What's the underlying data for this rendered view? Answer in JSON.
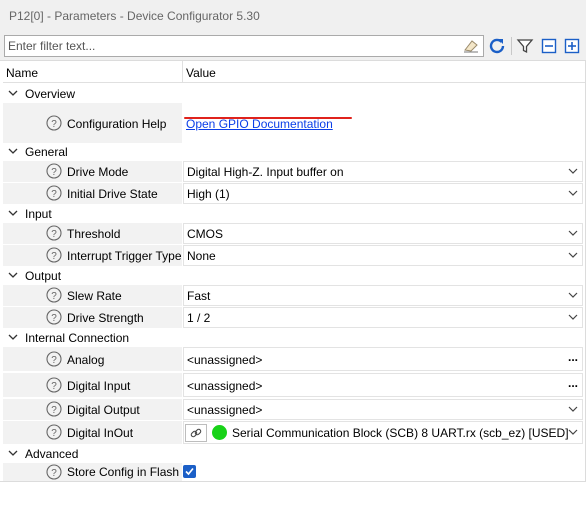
{
  "window": {
    "title": "P12[0] - Parameters - Device Configurator 5.30"
  },
  "filter": {
    "placeholder": "Enter filter text..."
  },
  "toolbar": {
    "icons": [
      "eraser-icon",
      "refresh-icon",
      "filter-icon",
      "collapse-icon",
      "expand-icon"
    ],
    "accent": "#1b5fc7"
  },
  "grid": {
    "headers": {
      "name": "Name",
      "value": "Value"
    },
    "overview": {
      "label": "Overview",
      "config_help": {
        "label": "Configuration Help",
        "value": "Open GPIO Documentation"
      }
    },
    "general": {
      "label": "General",
      "drive_mode": {
        "label": "Drive Mode",
        "value": "Digital High-Z. Input buffer on"
      },
      "initial_drive_state": {
        "label": "Initial Drive State",
        "value": "High (1)"
      }
    },
    "input": {
      "label": "Input",
      "threshold": {
        "label": "Threshold",
        "value": "CMOS"
      },
      "interrupt_trigger": {
        "label": "Interrupt Trigger Type",
        "value": "None"
      }
    },
    "output": {
      "label": "Output",
      "slew_rate": {
        "label": "Slew Rate",
        "value": "Fast"
      },
      "drive_strength": {
        "label": "Drive Strength",
        "value": "1 / 2"
      }
    },
    "internal_connection": {
      "label": "Internal Connection",
      "analog": {
        "label": "Analog",
        "value": "<unassigned>"
      },
      "digital_input": {
        "label": "Digital Input",
        "value": "<unassigned>"
      },
      "digital_output": {
        "label": "Digital Output",
        "value": "<unassigned>"
      },
      "digital_inout": {
        "label": "Digital InOut",
        "value": "Serial Communication Block (SCB) 8 UART.rx (scb_ez) [USED]",
        "status_color": "#18d218"
      }
    },
    "advanced": {
      "label": "Advanced",
      "store_config": {
        "label": "Store Config in Flash",
        "checked": true
      }
    }
  }
}
